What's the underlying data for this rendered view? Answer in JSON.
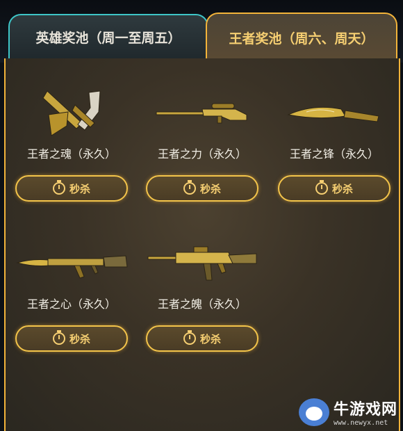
{
  "tabs": [
    {
      "label": "英雄奖池（周一至周五）",
      "active": false
    },
    {
      "label": "王者奖池（周六、周天）",
      "active": true
    }
  ],
  "items": [
    {
      "name": "王者之魂（永久）",
      "button": "秒杀",
      "icon": "crossed-pistol-icon"
    },
    {
      "name": "王者之力（永久）",
      "button": "秒杀",
      "icon": "sniper-rifle-icon"
    },
    {
      "name": "王者之锋（永久）",
      "button": "秒杀",
      "icon": "knife-icon"
    },
    {
      "name": "王者之心（永久）",
      "button": "秒杀",
      "icon": "ak-rifle-icon"
    },
    {
      "name": "王者之魄（永久）",
      "button": "秒杀",
      "icon": "m4-rifle-icon"
    }
  ],
  "watermark": {
    "title": "牛游戏网",
    "url": "www.newyx.net"
  },
  "colors": {
    "accent": "#f3b43a",
    "tab_inactive_border": "#3ec6c8",
    "text_gold": "#f6cf72"
  }
}
